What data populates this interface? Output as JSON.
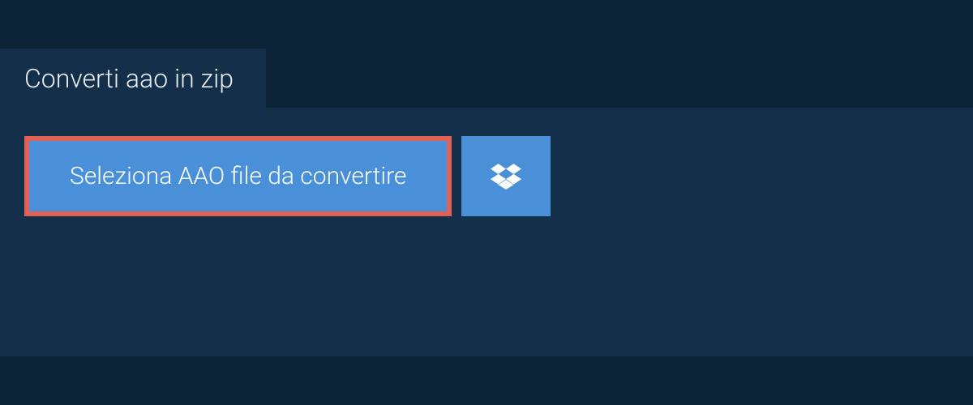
{
  "header": {
    "tab_label": "Converti aao in zip"
  },
  "actions": {
    "select_file_label": "Seleziona AAO file da convertire"
  }
}
